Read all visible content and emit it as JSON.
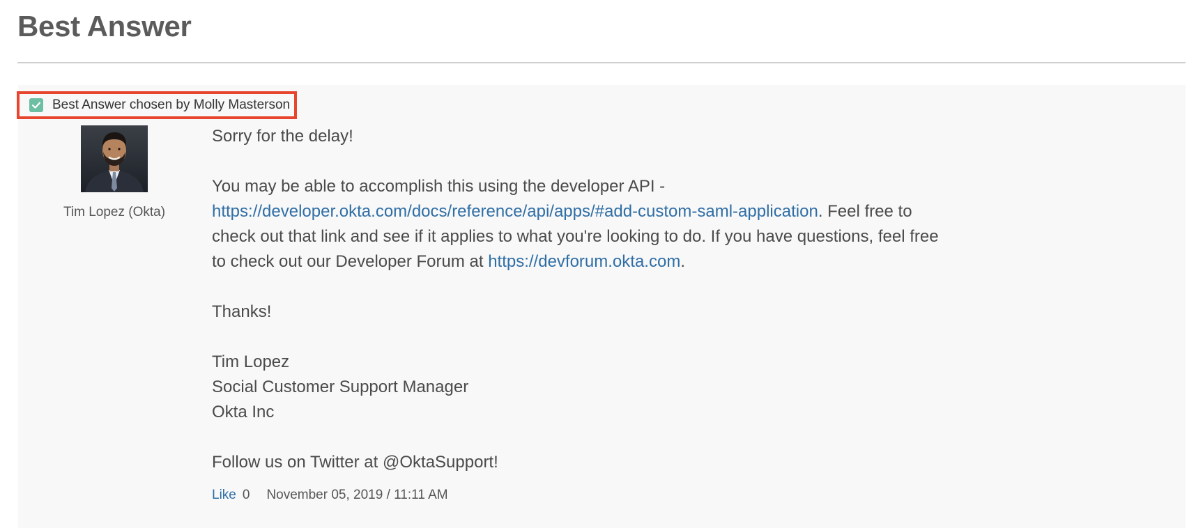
{
  "section": {
    "title": "Best Answer"
  },
  "badge": {
    "text": "Best Answer chosen by Molly Masterson",
    "icon": "checkbox-checked-icon",
    "icon_color": "#6cbfa3",
    "highlight_color": "#e8452f"
  },
  "author": {
    "name": "Tim Lopez (Okta)",
    "avatar": "avatar-photo"
  },
  "post": {
    "greeting": "Sorry for the delay!",
    "p2_before_link": "You may be able to accomplish this using the developer API -",
    "link1": "https://developer.okta.com/docs/reference/api/apps/#add-custom-saml-application",
    "p2_middle": ". Feel free to check out that link and see if it applies to what you're looking to do. If you have questions, feel free to check out our Developer Forum at ",
    "link2": "https://devforum.okta.com",
    "p2_end": ".",
    "thanks": "Thanks!",
    "signature": {
      "name": "Tim Lopez",
      "role": "Social Customer Support Manager",
      "company": "Okta Inc"
    },
    "follow": "Follow us on Twitter at @OktaSupport!"
  },
  "footer": {
    "like_label": "Like",
    "like_count": "0",
    "date": "November 05, 2019 / 11:11 AM"
  },
  "colors": {
    "link": "#2f6ea5",
    "panel_bg": "#f8f8f8"
  }
}
